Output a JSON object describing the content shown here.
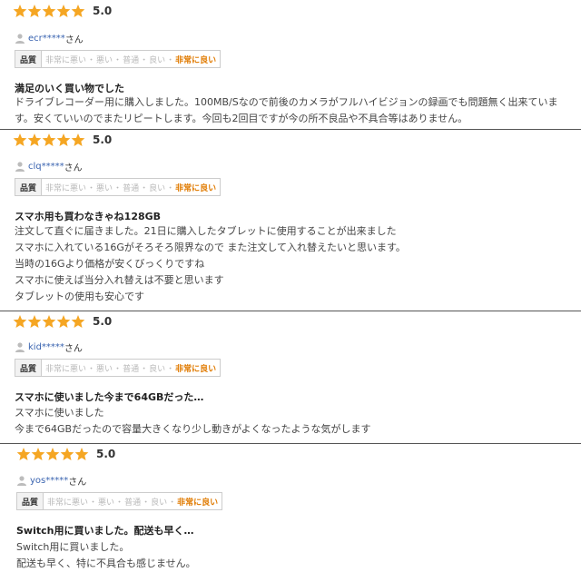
{
  "reviews": [
    {
      "score": "5.0",
      "stars": 5,
      "user": "ecr*****",
      "san": "さん",
      "quality_label": "品質",
      "quality_scale": [
        "非常に悪い",
        "悪い",
        "普通",
        "良い"
      ],
      "quality_selected": "非常に良い",
      "title": "満足のいく買い物でした",
      "body": [
        "ドライブレコーダー用に購入しました。100MB/Sなので前後のカメラがフルハイビジョンの録画でも問題無く出来ています。安くていいのでまたリピートします。今回も2回目ですが今の所不良品や不具合等はありません。"
      ]
    },
    {
      "score": "5.0",
      "stars": 5,
      "user": "clq*****",
      "san": "さん",
      "quality_label": "品質",
      "quality_scale": [
        "非常に悪い",
        "悪い",
        "普通",
        "良い"
      ],
      "quality_selected": "非常に良い",
      "title": "スマホ用も買わなきゃね128GB",
      "body": [
        "注文して直ぐに届きました。21日に購入したタブレットに使用することが出来ました",
        "スマホに入れている16Gがそろそろ限界なので また注文して入れ替えたいと思います。",
        "当時の16Gより価格が安くびっくりですね",
        "スマホに使えば当分入れ替えは不要と思います",
        "タブレットの使用も安心です"
      ]
    },
    {
      "score": "5.0",
      "stars": 5,
      "user": "kid*****",
      "san": "さん",
      "quality_label": "品質",
      "quality_scale": [
        "非常に悪い",
        "悪い",
        "普通",
        "良い"
      ],
      "quality_selected": "非常に良い",
      "title": "スマホに使いました今まで64GBだった…",
      "body": [
        "スマホに使いました",
        "今まで64GBだったので容量大きくなり少し動きがよくなったような気がします"
      ]
    },
    {
      "score": "5.0",
      "stars": 5,
      "user": "yos*****",
      "san": "さん",
      "quality_label": "品質",
      "quality_scale": [
        "非常に悪い",
        "悪い",
        "普通",
        "良い"
      ],
      "quality_selected": "非常に良い",
      "title": "Switch用に買いました。配送も早く…",
      "body": [
        "Switch用に買いました。",
        "配送も早く、特に不具合も感じません。"
      ]
    }
  ],
  "colors": {
    "star": "#f5a623",
    "username": "#3a64b0",
    "selected_quality": "#e07a00",
    "unselected_quality": "#b8b8b8"
  }
}
